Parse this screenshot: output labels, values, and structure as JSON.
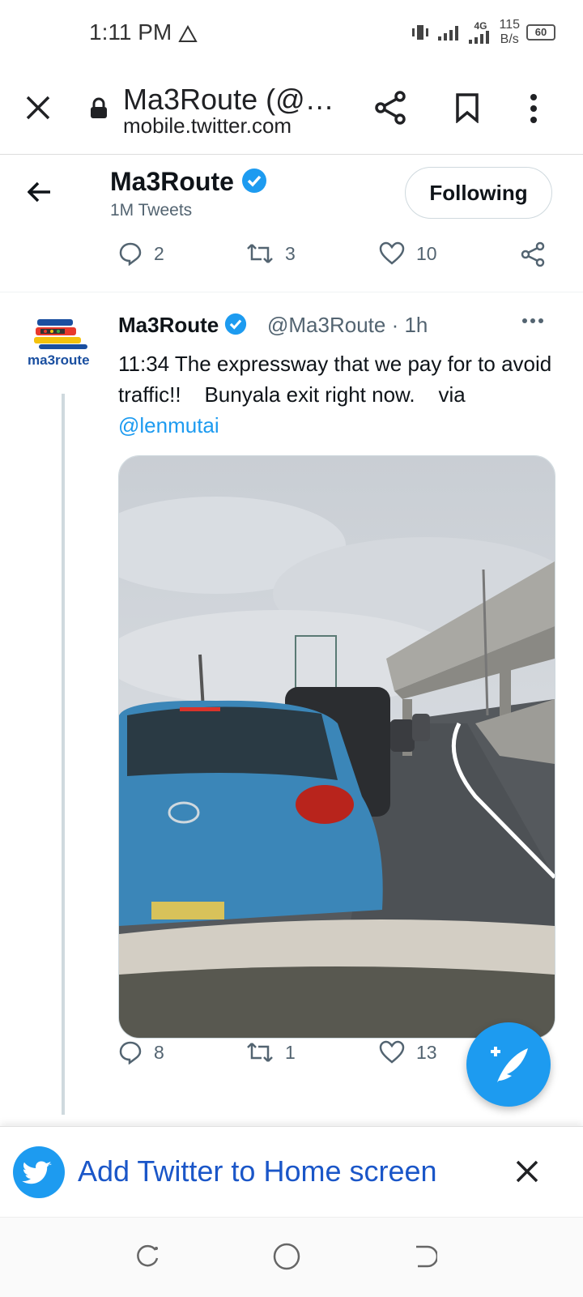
{
  "status_bar": {
    "time": "1:11 PM",
    "network": "4G",
    "speed_value": "115",
    "speed_unit": "B/s",
    "battery": "60"
  },
  "browser": {
    "page_title": "Ma3Route (@…",
    "url": "mobile.twitter.com"
  },
  "profile_header": {
    "name": "Ma3Route",
    "tweet_count": "1M Tweets",
    "follow_label": "Following"
  },
  "prev_tweet_actions": {
    "replies": "2",
    "retweets": "3",
    "likes": "10"
  },
  "tweet": {
    "name": "Ma3Route",
    "handle_time": "@Ma3Route · 1h",
    "avatar_text": "ma3route",
    "text": "11:34 The expressway that we pay for to avoid traffic!!    Bunyala exit right now.    via",
    "mention": "@lenmutai",
    "actions": {
      "replies": "8",
      "retweets": "1",
      "likes": "13"
    }
  },
  "banner": {
    "text": "Add Twitter to Home screen"
  },
  "colors": {
    "twitter_blue": "#1d9bf0",
    "banner_text": "#1a56c8"
  }
}
